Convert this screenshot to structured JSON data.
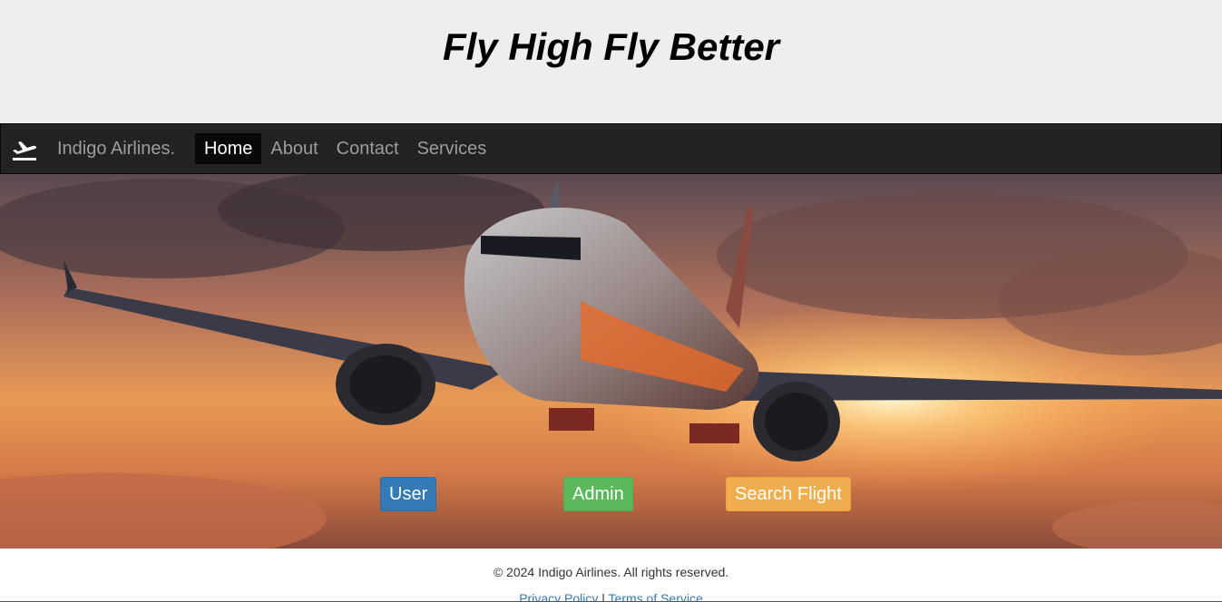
{
  "header": {
    "tagline": "Fly High Fly Better"
  },
  "navbar": {
    "logo_icon": "plane-departure-icon",
    "brand": "Indigo Airlines.",
    "links": [
      {
        "label": "Home",
        "active": true
      },
      {
        "label": "About",
        "active": false
      },
      {
        "label": "Contact",
        "active": false
      },
      {
        "label": "Services",
        "active": false
      }
    ]
  },
  "hero": {
    "image": "airplane flying over clouds at sunset",
    "buttons": {
      "user": "User",
      "admin": "Admin",
      "search_flight": "Search Flight"
    }
  },
  "footer": {
    "copyright": "© 2024 Indigo Airlines. All rights reserved.",
    "privacy": "Privacy Policy",
    "separator": "|",
    "terms": "Terms of Service"
  },
  "colors": {
    "navbar_bg": "#222222",
    "nav_active_bg": "#080808",
    "btn_user": "#337ab7",
    "btn_admin": "#5cb85c",
    "btn_search": "#f0ad4e",
    "banner_bg": "#eeeeee"
  }
}
